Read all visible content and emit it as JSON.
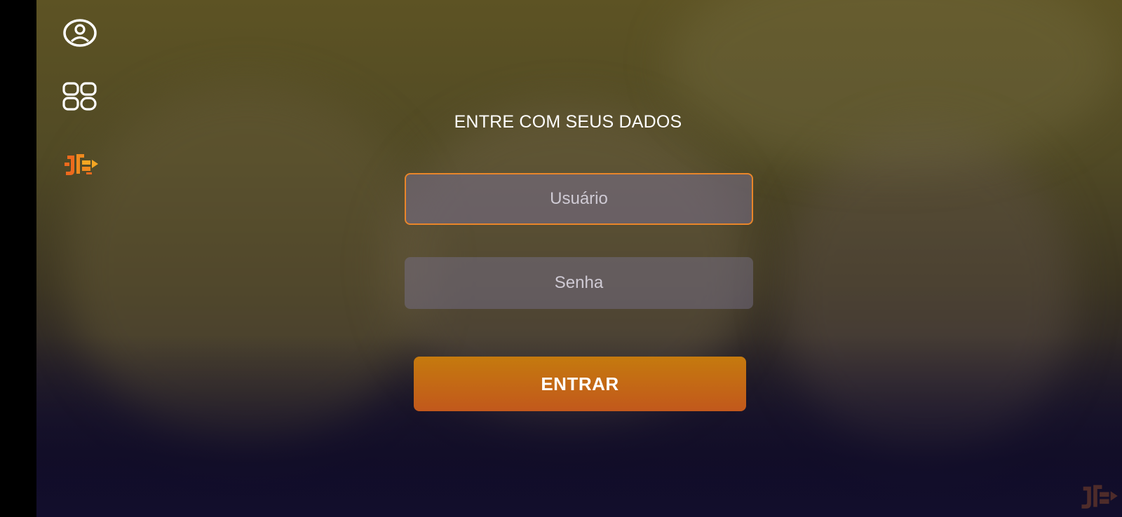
{
  "sidebar": {
    "items": [
      {
        "icon": "user-circle-icon"
      },
      {
        "icon": "apps-grid-icon"
      },
      {
        "icon": "brand-logo-icon"
      }
    ]
  },
  "login": {
    "title": "ENTRE COM SEUS DADOS",
    "username_placeholder": "Usuário",
    "password_placeholder": "Senha",
    "submit_label": "ENTRAR"
  },
  "colors": {
    "accent": "#E9862A",
    "button_top": "#C57A0E",
    "button_bottom": "#C2581C",
    "text": "#FFFFFF"
  }
}
